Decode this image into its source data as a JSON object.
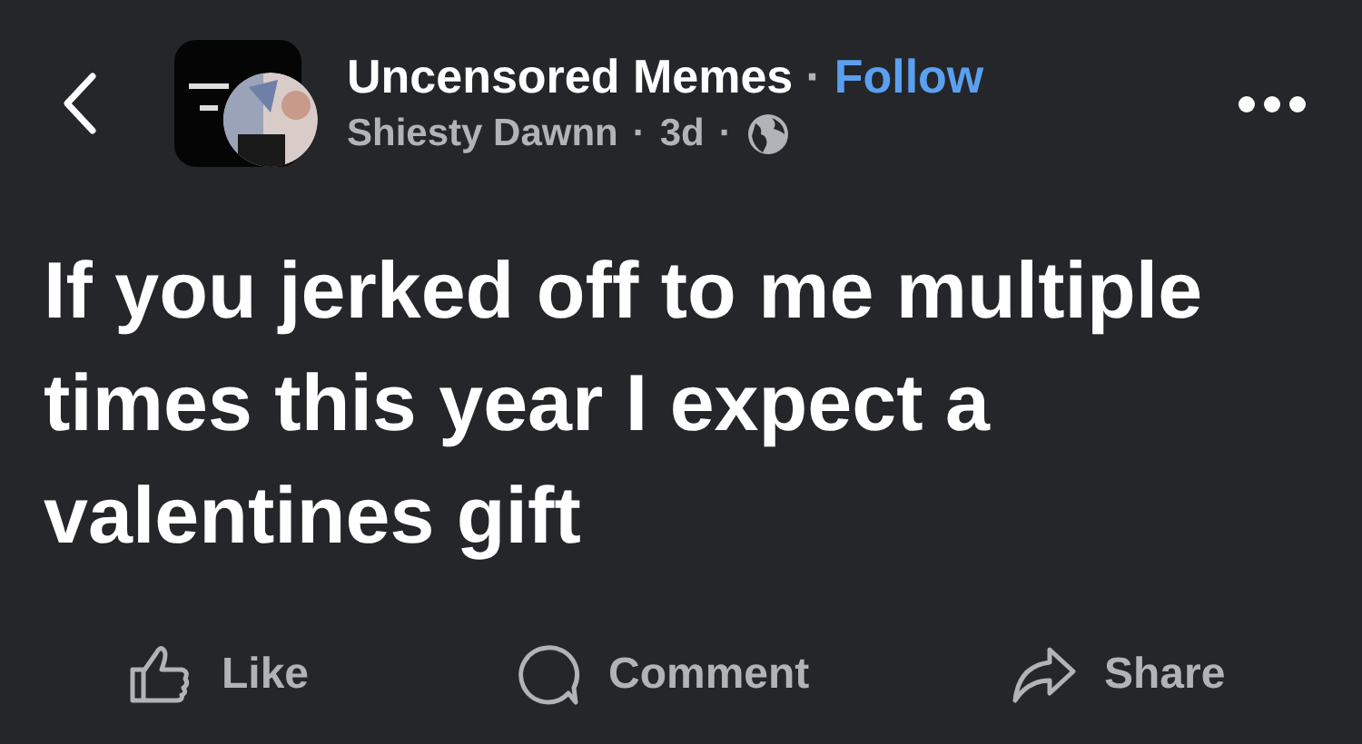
{
  "post": {
    "page_name": "Uncensored Memes",
    "separator": "·",
    "follow": "Follow",
    "author": "Shiesty Dawnn",
    "time": "3d",
    "time_separator": "·",
    "audience_separator": "·",
    "text": "If you jerked off to me multiple times this year I expect a valentines gift"
  },
  "actions": [
    {
      "label": "Like",
      "kind": "like"
    },
    {
      "label": "Comment",
      "kind": "comment"
    },
    {
      "label": "Share",
      "kind": "share"
    }
  ]
}
